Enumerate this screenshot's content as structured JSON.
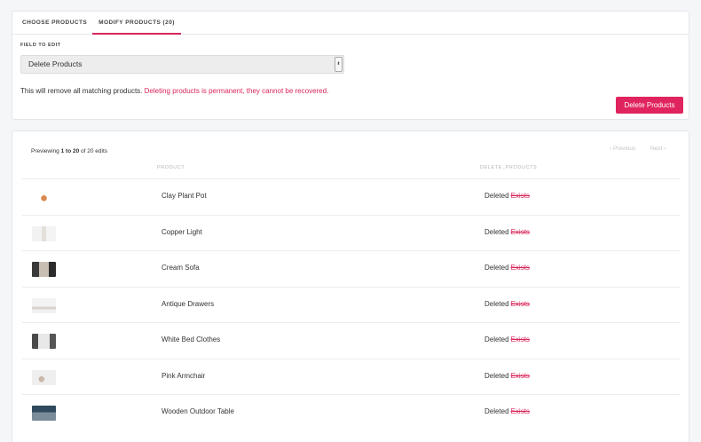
{
  "tabs": {
    "choose": "CHOOSE PRODUCTS",
    "modify": "MODIFY PRODUCTS (20)"
  },
  "editor": {
    "field_label": "FIELD TO EDIT",
    "selected_field": "Delete Products",
    "warning_text": "This will remove all matching products.",
    "warning_danger": "Deleting products is permanent, they cannot be recovered.",
    "delete_button": "Delete Products"
  },
  "preview": {
    "prefix": "Previewing",
    "range": "1 to 20",
    "suffix": "of 20 edits",
    "prev": "‹ Previous",
    "next": "Next ›"
  },
  "table": {
    "headers": [
      "PRODUCT",
      "DELETE_PRODUCTS"
    ],
    "rows": [
      {
        "name": "Clay Plant Pot",
        "new_value": "Deleted",
        "old_value": "Exists"
      },
      {
        "name": "Copper Light",
        "new_value": "Deleted",
        "old_value": "Exists"
      },
      {
        "name": "Cream Sofa",
        "new_value": "Deleted",
        "old_value": "Exists"
      },
      {
        "name": "Antique Drawers",
        "new_value": "Deleted",
        "old_value": "Exists"
      },
      {
        "name": "White Bed Clothes",
        "new_value": "Deleted",
        "old_value": "Exists"
      },
      {
        "name": "Pink Armchair",
        "new_value": "Deleted",
        "old_value": "Exists"
      },
      {
        "name": "Wooden Outdoor Table",
        "new_value": "Deleted",
        "old_value": "Exists"
      }
    ]
  },
  "colors": {
    "accent": "#e0245e",
    "danger_text": "#d9265a"
  }
}
